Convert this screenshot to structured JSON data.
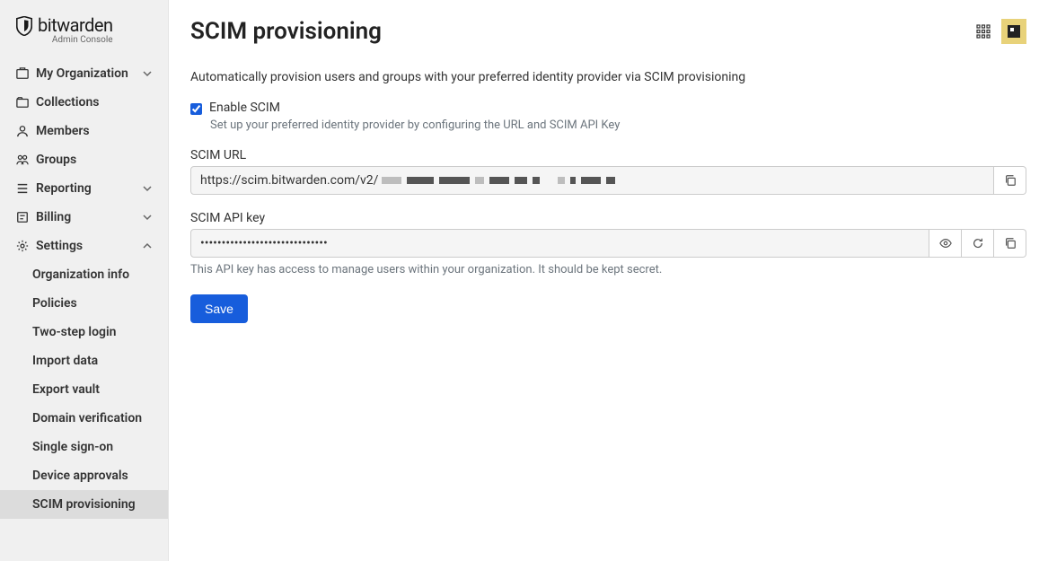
{
  "brand": {
    "name": "bitwarden",
    "sub": "Admin Console"
  },
  "sidebar": {
    "items": [
      {
        "label": "My Organization",
        "expandable": true
      },
      {
        "label": "Collections"
      },
      {
        "label": "Members"
      },
      {
        "label": "Groups"
      },
      {
        "label": "Reporting",
        "expandable": true
      },
      {
        "label": "Billing",
        "expandable": true
      },
      {
        "label": "Settings",
        "expandable": true,
        "expanded": true
      }
    ],
    "settings_children": [
      {
        "label": "Organization info"
      },
      {
        "label": "Policies"
      },
      {
        "label": "Two-step login"
      },
      {
        "label": "Import data"
      },
      {
        "label": "Export vault"
      },
      {
        "label": "Domain verification"
      },
      {
        "label": "Single sign-on"
      },
      {
        "label": "Device approvals"
      },
      {
        "label": "SCIM provisioning",
        "active": true
      }
    ]
  },
  "page": {
    "title": "SCIM provisioning",
    "description": "Automatically provision users and groups with your preferred identity provider via SCIM provisioning",
    "enable_label": "Enable SCIM",
    "enable_checked": true,
    "enable_help": "Set up your preferred identity provider by configuring the URL and SCIM API Key",
    "scim_url_label": "SCIM URL",
    "scim_url_prefix": "https://scim.bitwarden.com/v2/",
    "api_key_label": "SCIM API key",
    "api_key_value": "••••••••••••••••••••••••••••••",
    "api_key_help": "This API key has access to manage users within your organization. It should be kept secret.",
    "save_label": "Save"
  }
}
